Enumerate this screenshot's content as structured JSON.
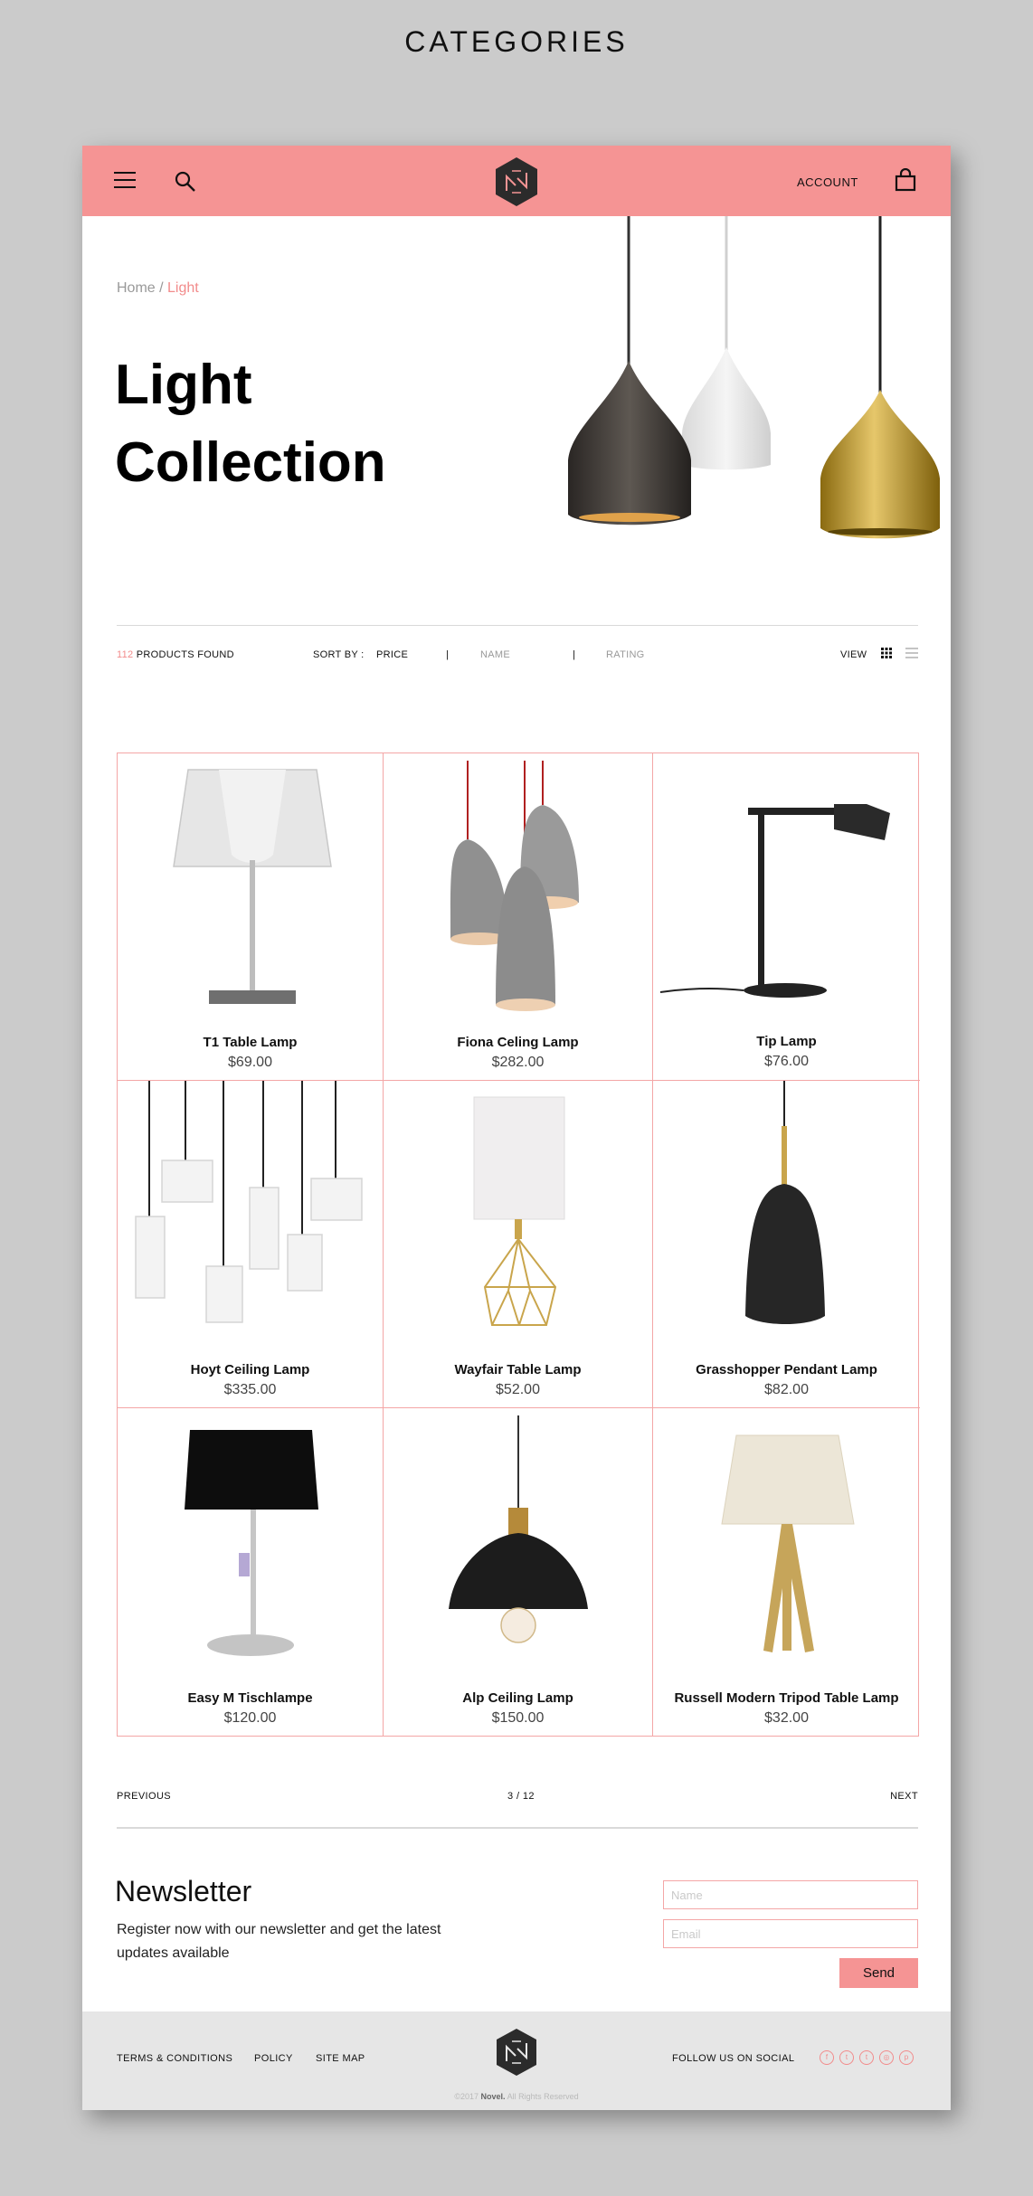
{
  "page_heading": "CATEGORIES",
  "header": {
    "menu_icon": "hamburger-menu-icon",
    "search_icon": "search-icon",
    "logo_icon": "novel-hexagon-logo-icon",
    "account_label": "ACCOUNT",
    "bag_icon": "shopping-bag-icon"
  },
  "breadcrumb": {
    "home": "Home",
    "separator": " / ",
    "current": "Light"
  },
  "hero": {
    "title_line1": "Light",
    "title_line2": "Collection"
  },
  "toolbar": {
    "count": "112",
    "found_label": " PRODUCTS FOUND",
    "sort_label": "SORT BY :",
    "sort_options": [
      "PRICE",
      "NAME",
      "RATING"
    ],
    "separator": "|",
    "view_label": "VIEW",
    "active_sort": "PRICE"
  },
  "products": [
    {
      "name": "T1 Table Lamp",
      "price": "$69.00"
    },
    {
      "name": "Fiona Celing Lamp",
      "price": "$282.00"
    },
    {
      "name": "Tip Lamp",
      "price": "$76.00"
    },
    {
      "name": "Hoyt Ceiling Lamp",
      "price": "$335.00"
    },
    {
      "name": "Wayfair Table Lamp",
      "price": "$52.00"
    },
    {
      "name": "Grasshopper Pendant Lamp",
      "price": "$82.00"
    },
    {
      "name": "Easy M Tischlampe",
      "price": "$120.00"
    },
    {
      "name": "Alp Ceiling Lamp",
      "price": "$150.00"
    },
    {
      "name": "Russell Modern Tripod Table Lamp",
      "price": "$32.00"
    }
  ],
  "pagination": {
    "previous": "PREVIOUS",
    "page": "3 / 12",
    "next": "NEXT"
  },
  "newsletter": {
    "title": "Newsletter",
    "text": "Register now with our newsletter and get the latest updates available",
    "name_placeholder": "Name",
    "email_placeholder": "Email",
    "send_label": "Send"
  },
  "footer": {
    "links": [
      "TERMS & CONDITIONS",
      "POLICY",
      "SITE MAP"
    ],
    "follow_label": "FOLLOW US ON SOCIAL",
    "social_icons": [
      "facebook-icon",
      "twitter-icon",
      "tumblr-icon",
      "instagram-icon",
      "pinterest-icon"
    ],
    "copyright_prefix": "©2017 ",
    "copyright_brand": "Novel.",
    "copyright_suffix": " All Rights Reserved"
  },
  "colors": {
    "accent": "#f59494",
    "accent_text": "#f28b8b",
    "grid_border": "#f4a6a6",
    "footer_bg": "#e6e6e6",
    "page_bg": "#cbcbcb"
  }
}
